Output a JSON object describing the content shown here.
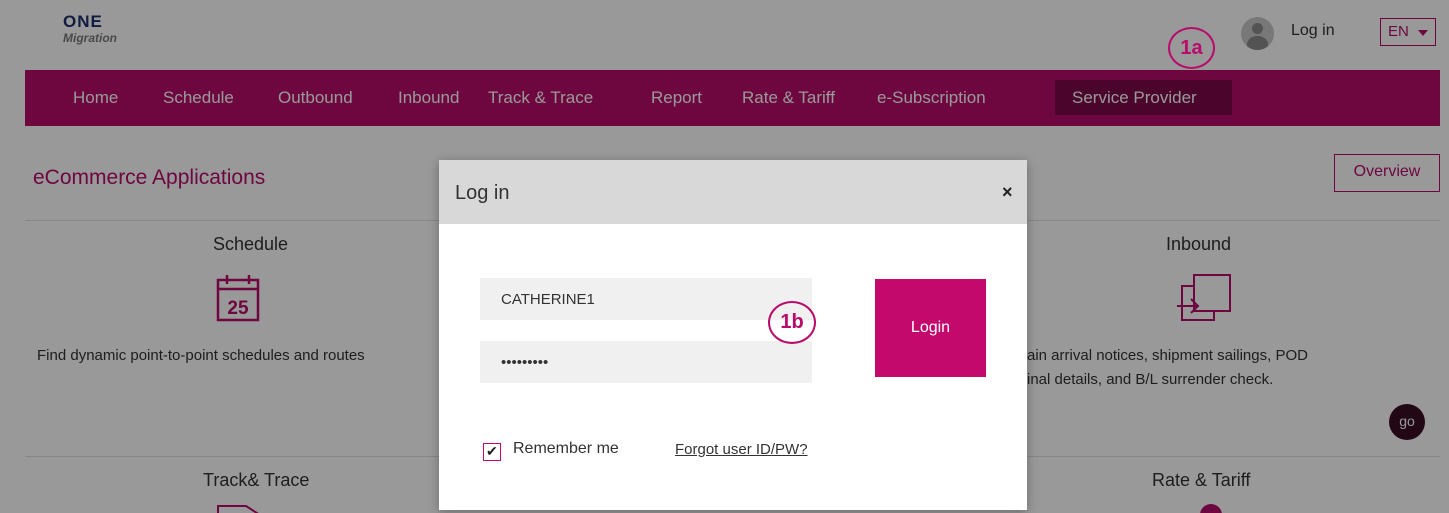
{
  "header": {
    "logo_line1": "ONE",
    "logo_line2": "Migration",
    "login_label": "Log in",
    "language": "EN"
  },
  "callouts": {
    "first": "1a",
    "second": "1b"
  },
  "nav": {
    "items": [
      "Home",
      "Schedule",
      "Outbound",
      "Inbound",
      "Track & Trace",
      "Report",
      "Rate & Tariff",
      "e-Subscription"
    ],
    "active": "Service Provider"
  },
  "content": {
    "section_title": "eCommerce Applications",
    "overview_label": "Overview",
    "schedule_title": "Schedule",
    "schedule_icon_number": "25",
    "schedule_desc": "Find dynamic point-to-point schedules and routes",
    "inbound_title": "Inbound",
    "inbound_desc_line1": "ain arrival notices, shipment sailings, POD",
    "inbound_desc_line2": "inal details, and B/L surrender check.",
    "go_label": "go",
    "track_title": "Track& Trace",
    "rate_title": "Rate & Tariff"
  },
  "modal": {
    "title": "Log in",
    "close_symbol": "×",
    "user_value": "CATHERINE1",
    "password_value": "•••••••••",
    "login_button": "Login",
    "remember_label": "Remember me",
    "remember_checked": true,
    "forgot_label": "Forgot user ID/PW?"
  },
  "colors": {
    "brand": "#b80c6b",
    "nav_active": "#7d0848",
    "login_button": "#c4096c"
  }
}
